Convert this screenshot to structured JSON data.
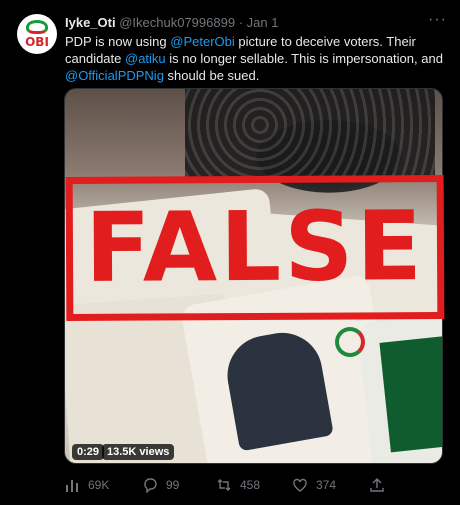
{
  "tweet": {
    "name": "Iyke_Oti",
    "handle": "@Ikechuk07996899",
    "separator": "·",
    "date": "Jan 1",
    "more": "···",
    "text": {
      "p1": "PDP is now using ",
      "m1": "@PeterObi",
      "p2": " picture to deceive voters. Their candidate ",
      "m2": "@atiku",
      "p3": " is no longer sellable. This is impersonation, and ",
      "m3": "@OfficialPDPNig",
      "p4": " should be sued."
    },
    "avatar_text": "OBI"
  },
  "media": {
    "stamp": "FALSE",
    "duration": "0:29",
    "views": "13.5K views"
  },
  "actions": {
    "views": "69K",
    "replies": "99",
    "retweets": "458",
    "likes": "374"
  },
  "colors": {
    "accent": "#1d9bf0",
    "stamp": "#e11d1d",
    "muted": "#71767b"
  }
}
